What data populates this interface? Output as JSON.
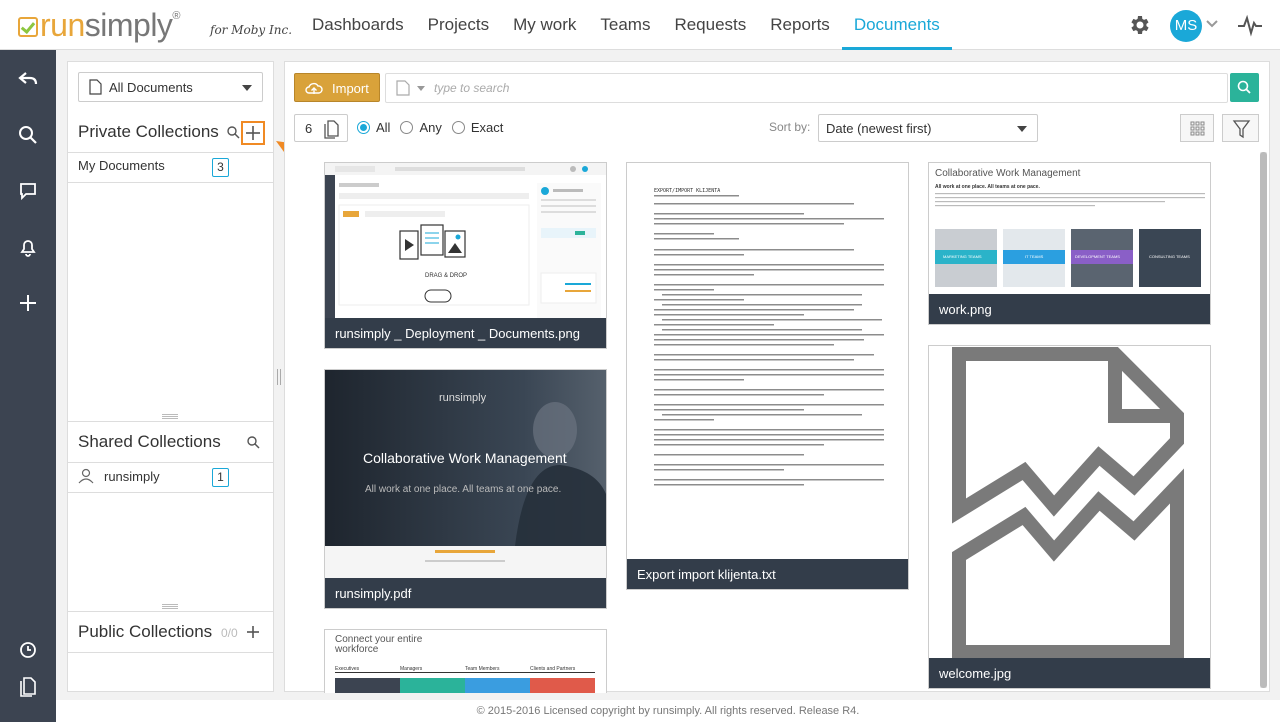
{
  "brand": {
    "run": "run",
    "simply": "simply",
    "reg": "®",
    "for": "for Moby Inc."
  },
  "nav": {
    "items": [
      "Dashboards",
      "Projects",
      "My work",
      "Teams",
      "Requests",
      "Reports",
      "Documents"
    ],
    "active": "Documents"
  },
  "user": {
    "initials": "MS"
  },
  "collections": {
    "filter_value": "All Documents",
    "private": {
      "title": "Private Collections",
      "items": [
        {
          "label": "My Documents",
          "count": "3"
        }
      ]
    },
    "shared": {
      "title": "Shared Collections",
      "items": [
        {
          "label": "runsimply",
          "count": "1"
        }
      ]
    },
    "public": {
      "title": "Public Collections",
      "count": "0/0"
    }
  },
  "callout": {
    "number": "1"
  },
  "toolbar": {
    "import_label": "Import",
    "search_placeholder": "type to search",
    "pages_count": "6",
    "radios": [
      "All",
      "Any",
      "Exact"
    ],
    "radio_selected": "All",
    "sort_label": "Sort by:",
    "sort_value": "Date (newest first)"
  },
  "documents": [
    {
      "name": "runsimply _ Deployment _ Documents.png"
    },
    {
      "name": "runsimply.pdf"
    },
    {
      "name": "Export import klijenta.txt"
    },
    {
      "name": "work.png"
    },
    {
      "name": "welcome.jpg"
    }
  ],
  "thumbs": {
    "deploy": {
      "drag": "DRAG & DROP"
    },
    "pdf": {
      "logo": "runsimply",
      "title": "Collaborative Work Management",
      "sub": "All work at one place. All teams at one pace."
    },
    "txt": {
      "heading": "EXPORT/IMPORT KLIJENTA"
    },
    "work": {
      "title": "Collaborative Work Management",
      "sub": "All work at one place. All teams at one pace.",
      "teams": [
        "MARKETING TEAMS",
        "IT TEAMS",
        "DEVELOPMENT TEAMS",
        "CONSULTING TEAMS"
      ]
    },
    "partial": {
      "title": "Connect your entire workforce",
      "cols": [
        "Executives",
        "Managers",
        "Team Members",
        "Clients and Partners"
      ]
    }
  },
  "colors": {
    "accent": "#1aa8d8",
    "orange": "#f08a24",
    "sidebar": "#3c4451",
    "caption": "#333d4a",
    "search": "#2bb39a"
  },
  "footer": "© 2015-2016 Licensed copyright by runsimply. All rights reserved. Release R4."
}
